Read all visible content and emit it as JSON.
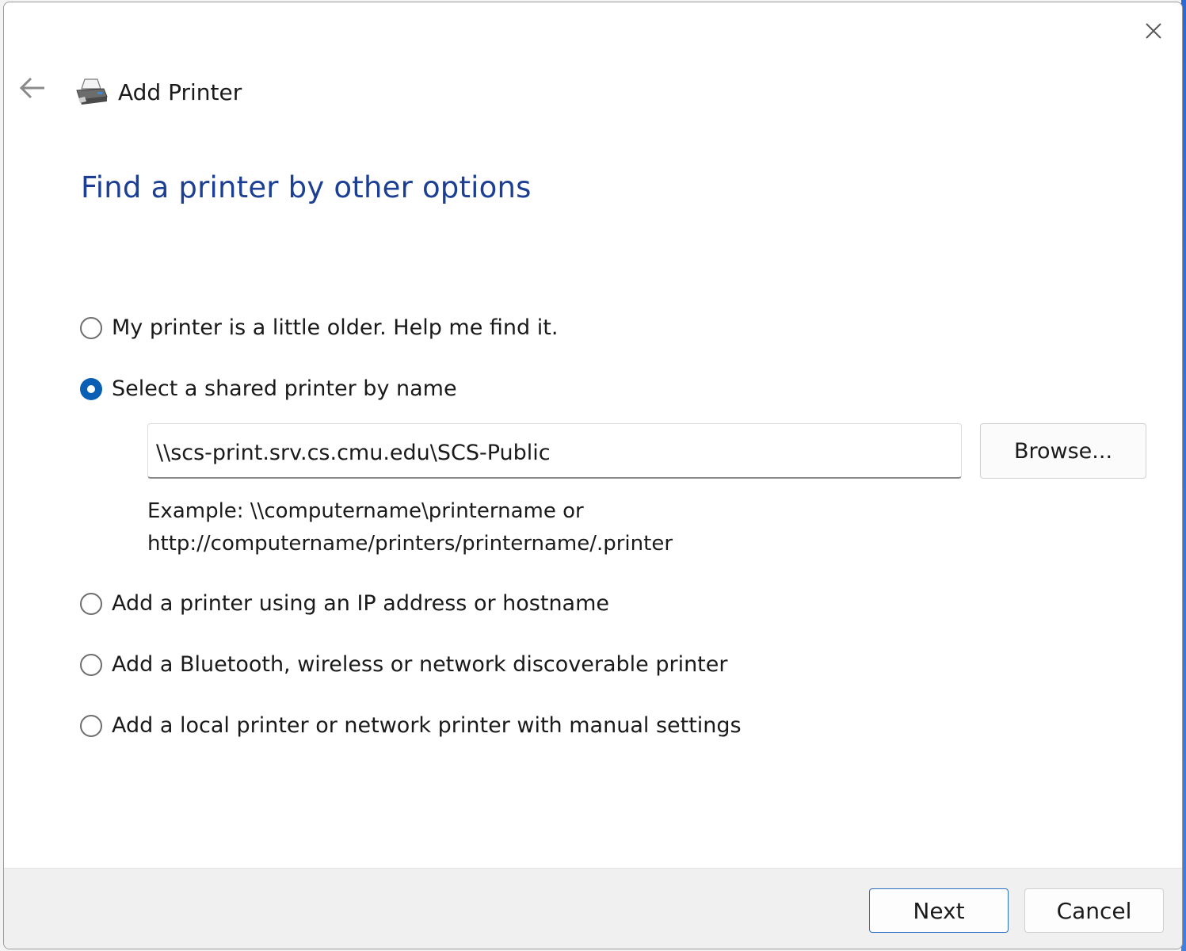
{
  "window": {
    "title": "Add Printer",
    "close_icon": "close-icon",
    "back_icon": "back-arrow-icon",
    "app_icon": "printer-icon"
  },
  "heading": "Find a printer by other options",
  "options": [
    {
      "label": "My printer is a little older. Help me find it.",
      "checked": false
    },
    {
      "label": "Select a shared printer by name",
      "checked": true
    },
    {
      "label": "Add a printer using an IP address or hostname",
      "checked": false
    },
    {
      "label": "Add a Bluetooth, wireless or network discoverable printer",
      "checked": false
    },
    {
      "label": "Add a local printer or network printer with manual settings",
      "checked": false
    }
  ],
  "shared_printer": {
    "value": "\\\\scs-print.srv.cs.cmu.edu\\SCS-Public",
    "browse_label": "Browse...",
    "example_line1": "Example: \\\\computername\\printername or",
    "example_line2": "http://computername/printers/printername/.printer"
  },
  "footer": {
    "next_label": "Next",
    "cancel_label": "Cancel"
  },
  "colors": {
    "heading": "#1c3f94",
    "accent": "#0a5fb5"
  }
}
